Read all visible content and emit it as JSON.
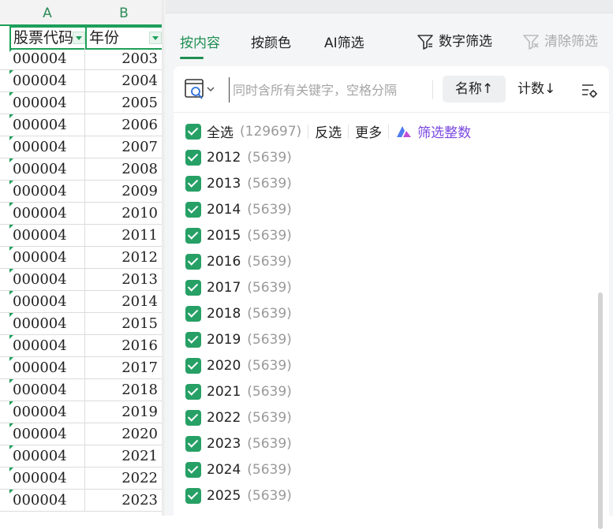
{
  "sheet": {
    "columns": [
      "A",
      "B"
    ],
    "header": [
      "股票代码",
      "年份"
    ],
    "rows": [
      [
        "000004",
        "2003"
      ],
      [
        "000004",
        "2004"
      ],
      [
        "000004",
        "2005"
      ],
      [
        "000004",
        "2006"
      ],
      [
        "000004",
        "2007"
      ],
      [
        "000004",
        "2008"
      ],
      [
        "000004",
        "2009"
      ],
      [
        "000004",
        "2010"
      ],
      [
        "000004",
        "2011"
      ],
      [
        "000004",
        "2012"
      ],
      [
        "000004",
        "2013"
      ],
      [
        "000004",
        "2014"
      ],
      [
        "000004",
        "2015"
      ],
      [
        "000004",
        "2016"
      ],
      [
        "000004",
        "2017"
      ],
      [
        "000004",
        "2018"
      ],
      [
        "000004",
        "2019"
      ],
      [
        "000004",
        "2020"
      ],
      [
        "000004",
        "2021"
      ],
      [
        "000004",
        "2022"
      ],
      [
        "000004",
        "2023"
      ]
    ]
  },
  "panel": {
    "tabs": [
      "按内容",
      "按颜色",
      "AI筛选"
    ],
    "active_tab": 0,
    "number_filter": "数字筛选",
    "clear_filter": "清除筛选",
    "search": {
      "placeholder": "同时含所有关键字，空格分隔",
      "value": ""
    },
    "sort_name": "名称↑",
    "sort_count": "计数↓",
    "select_all": {
      "label": "全选",
      "count": "(129697)",
      "checked": true
    },
    "invert": "反选",
    "more": "更多",
    "filter_integers": "筛选整数",
    "items": [
      {
        "value": "2012",
        "count": "(5639)",
        "checked": true
      },
      {
        "value": "2013",
        "count": "(5639)",
        "checked": true
      },
      {
        "value": "2014",
        "count": "(5639)",
        "checked": true
      },
      {
        "value": "2015",
        "count": "(5639)",
        "checked": true
      },
      {
        "value": "2016",
        "count": "(5639)",
        "checked": true
      },
      {
        "value": "2017",
        "count": "(5639)",
        "checked": true
      },
      {
        "value": "2018",
        "count": "(5639)",
        "checked": true
      },
      {
        "value": "2019",
        "count": "(5639)",
        "checked": true
      },
      {
        "value": "2020",
        "count": "(5639)",
        "checked": true
      },
      {
        "value": "2021",
        "count": "(5639)",
        "checked": true
      },
      {
        "value": "2022",
        "count": "(5639)",
        "checked": true
      },
      {
        "value": "2023",
        "count": "(5639)",
        "checked": true
      },
      {
        "value": "2024",
        "count": "(5639)",
        "checked": true
      },
      {
        "value": "2025",
        "count": "(5639)",
        "checked": true
      }
    ]
  },
  "colors": {
    "accent": "#1e8f52",
    "checkbox": "#27a066",
    "ai_purple": "#7a48e0"
  }
}
